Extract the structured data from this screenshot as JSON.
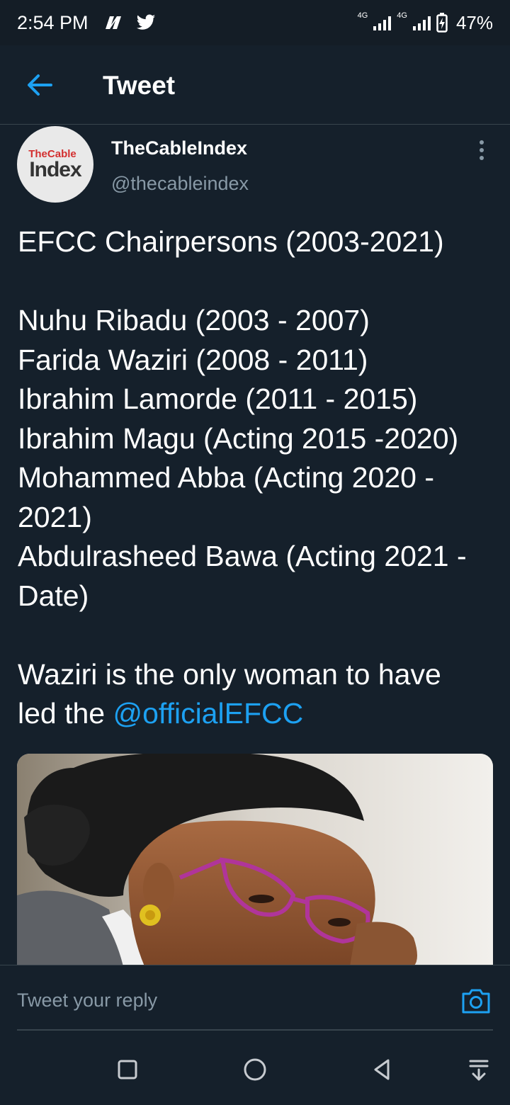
{
  "status_bar": {
    "time": "2:54 PM",
    "left_icons": [
      "news-icon",
      "twitter-bird-icon"
    ],
    "network_1": "4G",
    "network_2": "4G",
    "battery": "47%"
  },
  "header": {
    "title": "Tweet"
  },
  "tweet": {
    "author_name": "TheCableIndex",
    "author_handle": "@thecableindex",
    "avatar_text_top": "TheCable",
    "avatar_text_bottom": "Index",
    "title_line": "EFCC Chairpersons (2003-2021)",
    "lines": [
      "Nuhu Ribadu (2003 - 2007)",
      "Farida Waziri (2008 - 2011)",
      "Ibrahim Lamorde (2011 - 2015)",
      "Ibrahim Magu (Acting 2015 -2020)",
      "Mohammed Abba (Acting 2020 -",
      "2021)",
      "Abdulrasheed Bawa (Acting 2021 -",
      "Date)"
    ],
    "closing_line_1": "Waziri is the only woman to have",
    "closing_line_2_prefix": "led the ",
    "mention": "@officialEFCC"
  },
  "reply": {
    "placeholder": "Tweet your reply"
  },
  "colors": {
    "background": "#15202b",
    "accent": "#1da1f2",
    "secondary_text": "#8899a6"
  }
}
